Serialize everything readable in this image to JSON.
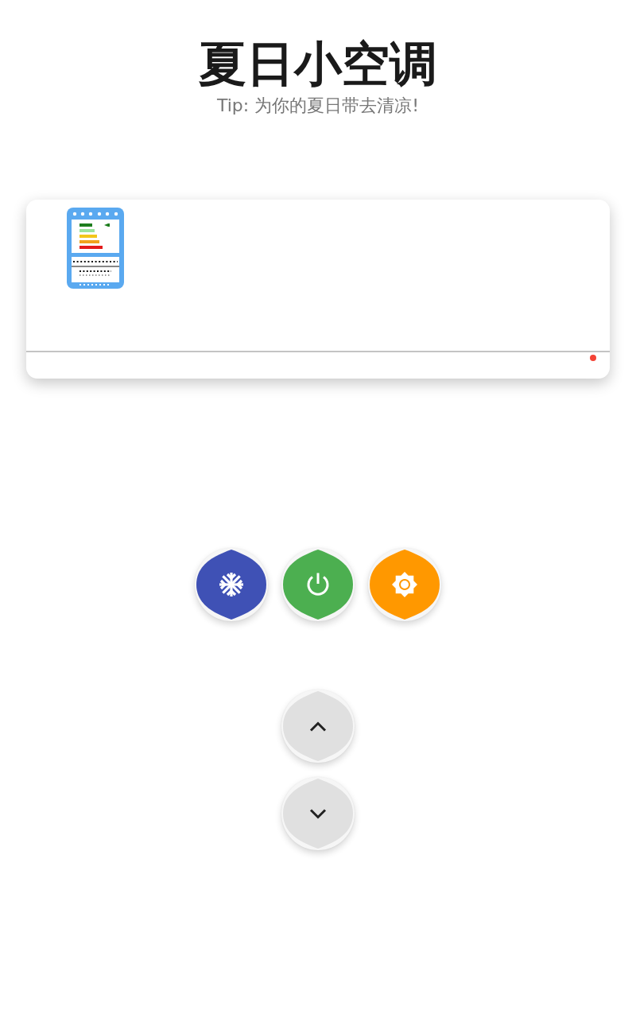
{
  "header": {
    "title": "夏日小空调",
    "tip": "Tip: 为你的夏日带去清凉!"
  },
  "mode_buttons": [
    {
      "kind": "cool",
      "color": "#3f51b5"
    },
    {
      "kind": "power",
      "color": "#4caf50"
    },
    {
      "kind": "heat",
      "color": "#ff9800"
    }
  ],
  "temperature_buttons": [
    {
      "kind": "up"
    },
    {
      "kind": "down"
    }
  ]
}
